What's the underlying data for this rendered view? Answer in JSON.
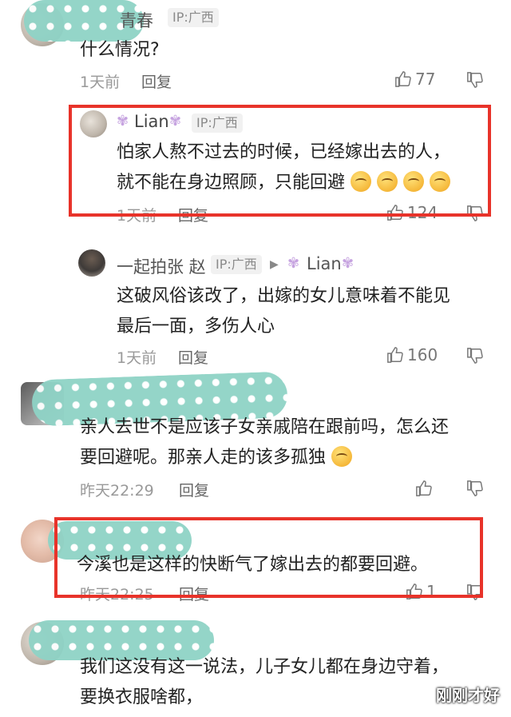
{
  "comments": [
    {
      "id": "c1",
      "name_tail": "青春",
      "ip": "IP:广西",
      "lines": [
        "什么情况?"
      ],
      "time": "1天前",
      "reply": "回复",
      "likes": "77"
    },
    {
      "id": "c2",
      "name": "Lian",
      "ip": "IP:广西",
      "lines": [
        "怕家人熬不过去的时候，已经嫁出去的人，",
        "就不能在身边照顾，只能回避"
      ],
      "time": "1天前",
      "reply": "回复",
      "likes": "124"
    },
    {
      "id": "c3",
      "name": "一起拍张 赵",
      "ip": "IP:广西",
      "reply_to": "Lian",
      "lines": [
        "这破风俗该改了，出嫁的女儿意味着不能见",
        "最后一面，多伤人心"
      ],
      "time": "1天前",
      "reply": "回复",
      "likes": "160"
    },
    {
      "id": "c4",
      "lines": [
        "亲人去世不是应该子女亲戚陪在跟前吗，怎么还",
        "要回避呢。那亲人走的该多孤独"
      ],
      "time": "昨天22:29",
      "reply": "回复"
    },
    {
      "id": "c5",
      "lines": [
        "今溪也是这样的快断气了嫁出去的都要回避。"
      ],
      "time": "昨天22:25",
      "reply": "回复",
      "likes": "1"
    },
    {
      "id": "c6",
      "lines": [
        "我们这没有这一说法，儿子女儿都在身边守着，",
        "要换衣服啥都，"
      ]
    }
  ],
  "watermark": "刚刚才好",
  "colors": {
    "highlight_border": "#e8332a",
    "redaction": "#8fd3c6"
  },
  "icons": [
    "thumb-up-icon",
    "thumb-down-icon",
    "crying-emoji",
    "pleading-emoji",
    "fairy-badge-icon"
  ]
}
